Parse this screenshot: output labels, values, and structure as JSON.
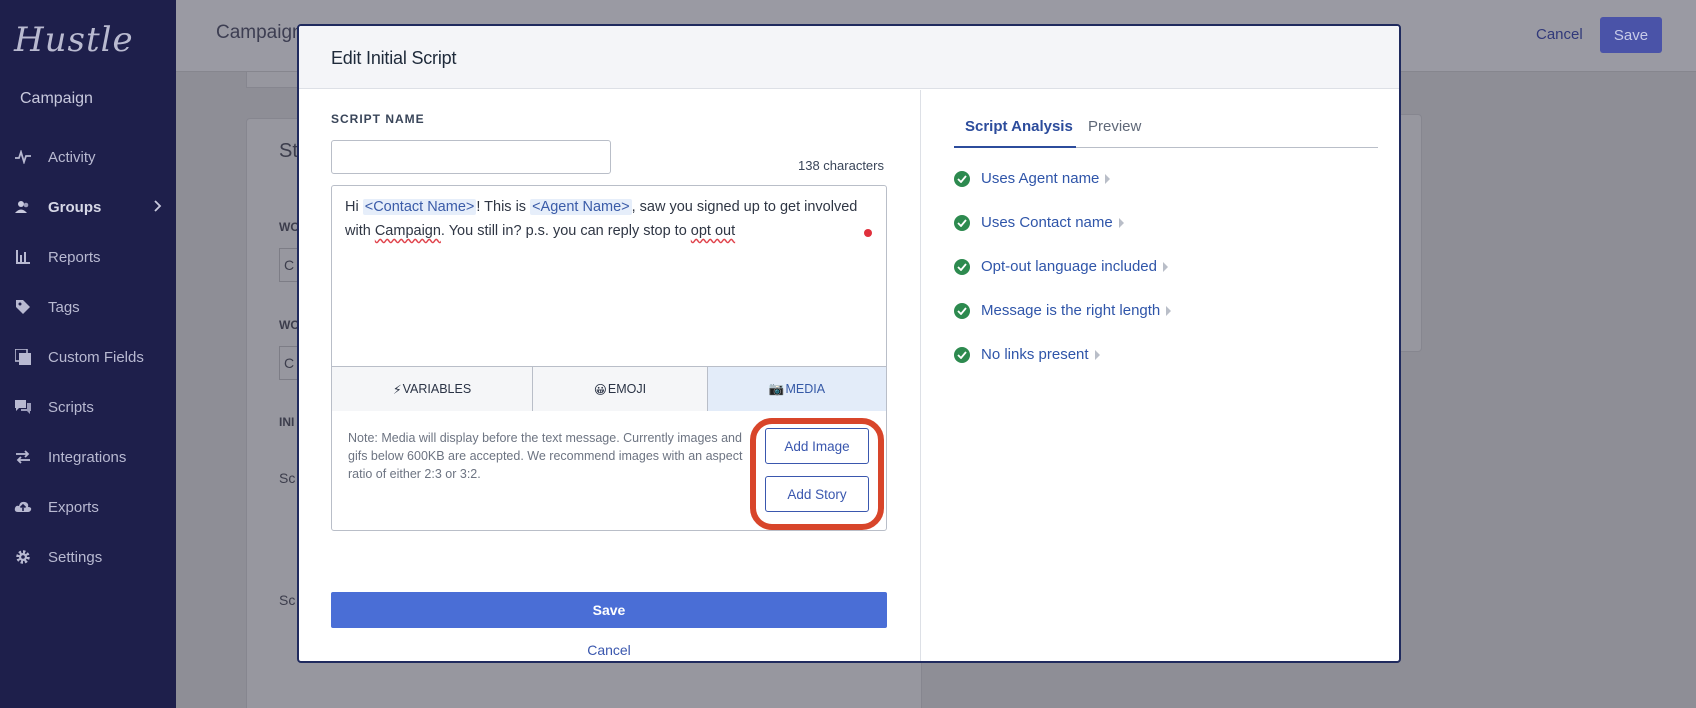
{
  "app": {
    "logo": "Hustle",
    "section": "Campaign"
  },
  "sidebar": {
    "items": [
      {
        "label": "Activity",
        "icon": "activity-icon"
      },
      {
        "label": "Groups",
        "icon": "groups-icon"
      },
      {
        "label": "Reports",
        "icon": "reports-icon"
      },
      {
        "label": "Tags",
        "icon": "tag-icon"
      },
      {
        "label": "Custom Fields",
        "icon": "custom-fields-icon"
      },
      {
        "label": "Scripts",
        "icon": "scripts-icon"
      },
      {
        "label": "Integrations",
        "icon": "integrations-icon"
      },
      {
        "label": "Exports",
        "icon": "exports-icon"
      },
      {
        "label": "Settings",
        "icon": "gear-icon"
      }
    ]
  },
  "background": {
    "title": "Campaign",
    "cancel": "Cancel",
    "save": "Save",
    "card_title_fragment": "St",
    "label_1": "WO",
    "label_2": "WO",
    "label_3": "INI",
    "label_4": "Sc",
    "label_5": "Sc",
    "input_1": "C",
    "input_2": "C"
  },
  "modal": {
    "title": "Edit Initial Script",
    "script_name_label": "SCRIPT NAME",
    "script_name_value": "",
    "char_count": "138 characters",
    "message": {
      "t1": "Hi ",
      "var1": "<Contact Name>",
      "t2": "! This is ",
      "var2": "<Agent Name>",
      "t3": ", saw you signed up to get involved with ",
      "t4": "Campaign",
      "t5": ". You still in? p.s. you can reply stop to ",
      "t6": "opt out"
    },
    "toolbar": {
      "variables": "VARIABLES",
      "variables_glyph": "⚡",
      "emoji": "EMOJI",
      "emoji_glyph": "😀",
      "media": "MEDIA",
      "media_glyph": "📷"
    },
    "media_note": "Note: Media will display before the text message. Currently images and gifs below 600KB are accepted. We recommend images with an aspect ratio of either 2:3 or 3:2.",
    "add_image": "Add Image",
    "add_story": "Add Story",
    "save": "Save",
    "cancel": "Cancel",
    "tabs": [
      "Script Analysis",
      "Preview"
    ],
    "analysis": [
      "Uses Agent name",
      "Uses Contact name",
      "Opt-out language included",
      "Message is the right length",
      "No links present"
    ]
  },
  "colors": {
    "sidebar": "#1e1f4b",
    "primary": "#4a6ed6",
    "link": "#2f55a9",
    "success": "#2d8a4f",
    "highlight": "#d8452a"
  }
}
